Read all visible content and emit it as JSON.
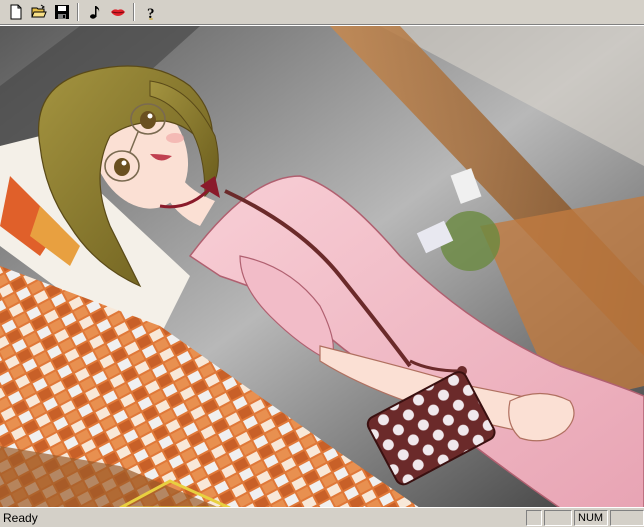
{
  "toolbar": {
    "buttons": [
      {
        "name": "new-file",
        "icon": "new-document-icon"
      },
      {
        "name": "open-file",
        "icon": "open-folder-icon"
      },
      {
        "name": "save-file",
        "icon": "floppy-disk-icon"
      },
      {
        "name": "music",
        "icon": "music-note-icon"
      },
      {
        "name": "voice",
        "icon": "lips-icon"
      },
      {
        "name": "help",
        "icon": "help-icon"
      }
    ],
    "help_glyph": "?"
  },
  "viewport": {
    "image_subject": "illustrated-girl-in-pink-dress"
  },
  "statusbar": {
    "text": "Ready",
    "panes": [
      "",
      "",
      "NUM",
      ""
    ]
  },
  "colors": {
    "chrome": "#d4d0c8",
    "dress": "#f3b9c6",
    "hair": "#8a7a2c",
    "floor_orange": "#e0843a",
    "bag": "#6b2a2a"
  }
}
